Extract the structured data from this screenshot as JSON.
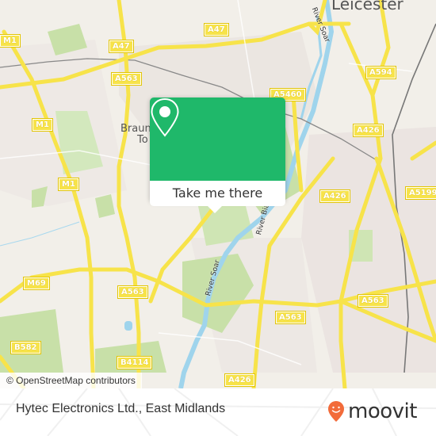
{
  "map": {
    "attribution": "© OpenStreetMap contributors",
    "city_label": "Leicester",
    "place_labels": [
      {
        "id": "braunstone-line1",
        "text": "Braun"
      },
      {
        "id": "braunstone-line2",
        "text": "To"
      }
    ],
    "road_labels": [
      "M1",
      "A47",
      "A47",
      "A563",
      "A5460",
      "A594",
      "A426",
      "A5199",
      "M1",
      "M1",
      "A426",
      "M69",
      "A563",
      "A563",
      "A563",
      "B582",
      "B4114",
      "A426"
    ],
    "river_labels": [
      "River Soar",
      "River Soar",
      "River Biam"
    ]
  },
  "popup": {
    "icon": "map-pin-icon",
    "button_label": "Take me there"
  },
  "footer": {
    "title": "Hytec Electronics Ltd., East Midlands",
    "logo_text": "moovit",
    "logo_icon": "moovit-pin-icon"
  },
  "colors": {
    "popup_green": "#1fb86a",
    "road_yellow": "#f7e34a",
    "water": "#9fd4ec",
    "park": "#c8e0a8",
    "moovit_orange": "#f26b3a"
  }
}
